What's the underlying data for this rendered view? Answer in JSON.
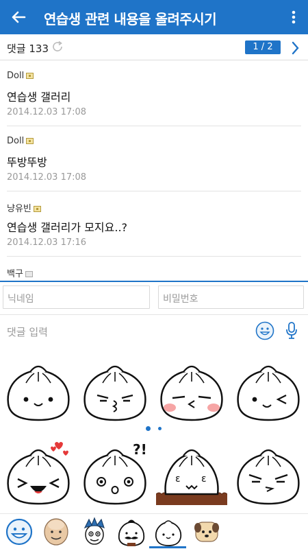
{
  "header": {
    "title": "연습생 관련 내용을 올려주시기",
    "back_icon": "arrow-left-icon",
    "menu_icon": "more-vert-icon"
  },
  "comments_bar": {
    "count_label": "댓글 133",
    "pager": "1 / 2"
  },
  "comments": [
    {
      "author": "Doll",
      "text": "연습생 갤러리",
      "date": "2014.12.03 17:08"
    },
    {
      "author": "Doll",
      "text": "뚜방뚜방",
      "date": "2014.12.03 17:08"
    },
    {
      "author": "냥유빈",
      "text": "연습생 갤러리가 모지요..?",
      "date": "2014.12.03 17:16"
    },
    {
      "author": "백구",
      "text": "",
      "date": ""
    }
  ],
  "form": {
    "nickname_placeholder": "닉네임",
    "password_placeholder": "비밀번호",
    "comment_placeholder": "댓글 입력"
  },
  "stickers": {
    "row1": [
      "dumpling-smile-icon",
      "dumpling-pout-icon",
      "dumpling-blush-kiss-icon",
      "dumpling-wink-icon"
    ],
    "row2": [
      "dumpling-love-laugh-icon",
      "dumpling-surprised-icon",
      "dumpling-sitting-icon",
      "dumpling-smirk-icon"
    ],
    "page_indicator": {
      "current": 1,
      "total": 2
    }
  },
  "sticker_tabs": [
    "smile-face-icon",
    "bald-man-icon",
    "blue-hair-icon",
    "mustache-dumpling-icon",
    "dumpling-icon",
    "puppy-icon"
  ],
  "active_tab": 4,
  "colors": {
    "primary": "#1f74c8",
    "header_text": "#ffffff",
    "date_gray": "#999999"
  }
}
